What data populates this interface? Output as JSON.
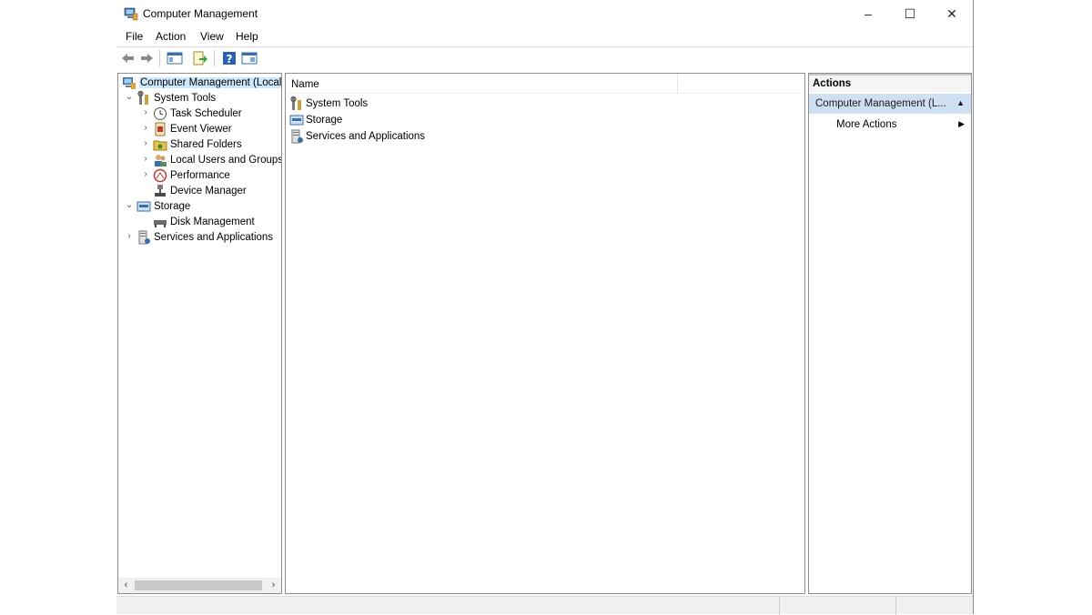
{
  "window": {
    "title": "Computer Management",
    "controls": {
      "minimize": "–",
      "maximize": "☐",
      "close": "✕"
    }
  },
  "menu": [
    "File",
    "Action",
    "View",
    "Help"
  ],
  "toolbar": {
    "buttons": [
      "back-icon",
      "forward-icon",
      "show-hide-console-tree-icon",
      "export-list-icon",
      "help-icon",
      "show-hide-action-pane-icon"
    ]
  },
  "tree": {
    "items": [
      {
        "label": "Computer Management (Local",
        "icon": "computer-management-icon",
        "arrow": "",
        "selected": true
      },
      {
        "label": "System Tools",
        "icon": "system-tools-icon",
        "arrow": "⌄"
      },
      {
        "label": "Task Scheduler",
        "icon": "clock-icon",
        "arrow": "›"
      },
      {
        "label": "Event Viewer",
        "icon": "event-viewer-icon",
        "arrow": "›"
      },
      {
        "label": "Shared Folders",
        "icon": "shared-folders-icon",
        "arrow": "›"
      },
      {
        "label": "Local Users and Groups",
        "icon": "users-icon",
        "arrow": "›"
      },
      {
        "label": "Performance",
        "icon": "performance-icon",
        "arrow": "›"
      },
      {
        "label": "Device Manager",
        "icon": "device-manager-icon",
        "arrow": ""
      },
      {
        "label": "Storage",
        "icon": "storage-icon",
        "arrow": "⌄"
      },
      {
        "label": "Disk Management",
        "icon": "disk-icon",
        "arrow": ""
      },
      {
        "label": "Services and Applications",
        "icon": "services-icon",
        "arrow": "›"
      }
    ],
    "scroll_left": "‹",
    "scroll_right": "›"
  },
  "list": {
    "column": "Name",
    "items": [
      {
        "label": "System Tools",
        "icon": "system-tools-icon"
      },
      {
        "label": "Storage",
        "icon": "storage-icon"
      },
      {
        "label": "Services and Applications",
        "icon": "services-icon"
      }
    ]
  },
  "actions": {
    "header": "Actions",
    "section": "Computer Management (L...",
    "section_arrow": "▲",
    "more_actions": "More Actions",
    "more_arrow": "▶"
  },
  "colors": {
    "selection": "#cce8ff",
    "actions_section_bg": "#cfe0f2"
  }
}
